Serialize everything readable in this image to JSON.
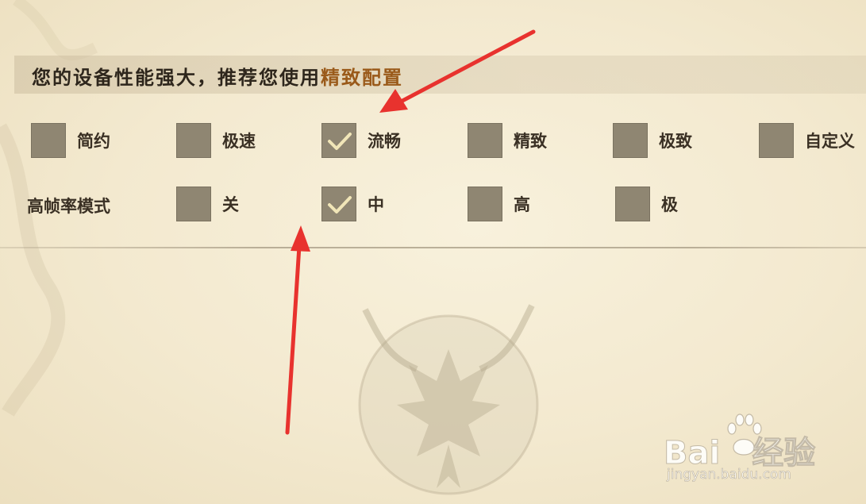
{
  "banner": {
    "text": "您的设备性能强大，推荐您使用",
    "highlight": "精致配置"
  },
  "quality": {
    "options": [
      {
        "label": "简约",
        "checked": false
      },
      {
        "label": "极速",
        "checked": false
      },
      {
        "label": "流畅",
        "checked": true
      },
      {
        "label": "精致",
        "checked": false
      },
      {
        "label": "极致",
        "checked": false
      },
      {
        "label": "自定义",
        "checked": false
      }
    ]
  },
  "framerate": {
    "label": "高帧率模式",
    "options": [
      {
        "label": "关",
        "checked": false
      },
      {
        "label": "中",
        "checked": true
      },
      {
        "label": "高",
        "checked": false
      },
      {
        "label": "极",
        "checked": false
      }
    ]
  },
  "watermark": {
    "brand_left": "Bai",
    "brand_right": "经验",
    "url": "jingyan.baidu.com"
  },
  "colors": {
    "checkbox": "#8f8672",
    "checkmark": "#f1e6b8",
    "highlight": "#9a5a1a",
    "arrow": "#e8322e"
  },
  "icons": {
    "check": "check-icon",
    "emblem": "dragon-emblem-icon",
    "arrow": "red-arrow-icon",
    "paw": "baidu-paw-icon"
  }
}
